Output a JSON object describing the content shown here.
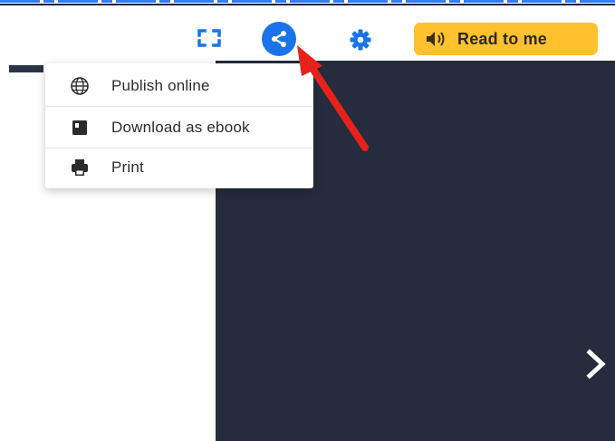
{
  "toolbar": {
    "fullscreen_icon": "fullscreen-icon",
    "share_icon": "share-icon",
    "settings_icon": "gear-icon",
    "read_to_me": {
      "label": "Read to me",
      "icon": "speaker-icon",
      "color": "#ffc12e"
    },
    "share_color": "#1a73e8"
  },
  "share_menu": {
    "items": [
      {
        "label": "Publish online",
        "icon": "globe-icon"
      },
      {
        "label": "Download as ebook",
        "icon": "book-icon"
      },
      {
        "label": "Print",
        "icon": "printer-icon"
      }
    ]
  },
  "viewer": {
    "background": "#252c3d",
    "next_icon": "chevron-right-icon"
  },
  "annotation": {
    "arrow_color": "#e8211b"
  }
}
